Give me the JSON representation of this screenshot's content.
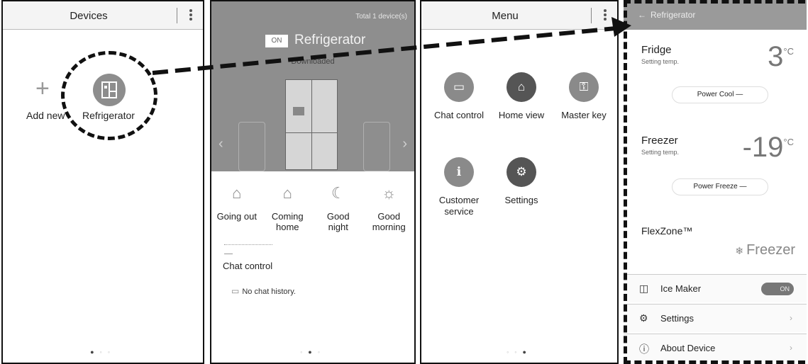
{
  "devices_screen": {
    "title": "Devices",
    "add_label": "Add new",
    "device_label": "Refrigerator"
  },
  "device_screen": {
    "total": "Total 1 device(s)",
    "power_badge": "ON",
    "device_name": "Refrigerator",
    "subtitle": "Downloaded",
    "modes": [
      {
        "icon": "going-out-icon",
        "label_line1": "Going out",
        "label_line2": ""
      },
      {
        "icon": "coming-home-icon",
        "label_line1": "Coming",
        "label_line2": "home"
      },
      {
        "icon": "good-night-icon",
        "label_line1": "Good",
        "label_line2": "night"
      },
      {
        "icon": "good-morning-icon",
        "label_line1": "Good",
        "label_line2": "morning"
      }
    ],
    "chat_title": "Chat control",
    "chat_empty": "No chat history."
  },
  "menu_screen": {
    "title": "Menu",
    "tiles": [
      {
        "icon": "chat-icon",
        "label_line1": "Chat control",
        "label_line2": ""
      },
      {
        "icon": "home-view-icon",
        "label_line1": "Home view",
        "label_line2": ""
      },
      {
        "icon": "master-key-icon",
        "label_line1": "Master key",
        "label_line2": ""
      },
      {
        "icon": "customer-service-icon",
        "label_line1": "Customer",
        "label_line2": "service"
      },
      {
        "icon": "settings-icon",
        "label_line1": "Settings",
        "label_line2": ""
      }
    ]
  },
  "fridge_screen": {
    "title": "Refrigerator",
    "fridge": {
      "name": "Fridge",
      "sub": "Setting temp.",
      "value": "3",
      "unit": "°C",
      "button": "Power Cool"
    },
    "freezer": {
      "name": "Freezer",
      "sub": "Setting temp.",
      "value": "-19",
      "unit": "°C",
      "button": "Power Freeze"
    },
    "flexzone": {
      "name": "FlexZone™",
      "mode": "Freezer"
    },
    "ice_maker": {
      "label": "Ice Maker",
      "toggle": "ON"
    },
    "settings": {
      "label": "Settings"
    },
    "about": {
      "label": "About Device"
    }
  },
  "colors": {
    "header_grey": "#9a9a9a",
    "hero_grey": "#8e8e8e",
    "dash_black": "#111111"
  }
}
